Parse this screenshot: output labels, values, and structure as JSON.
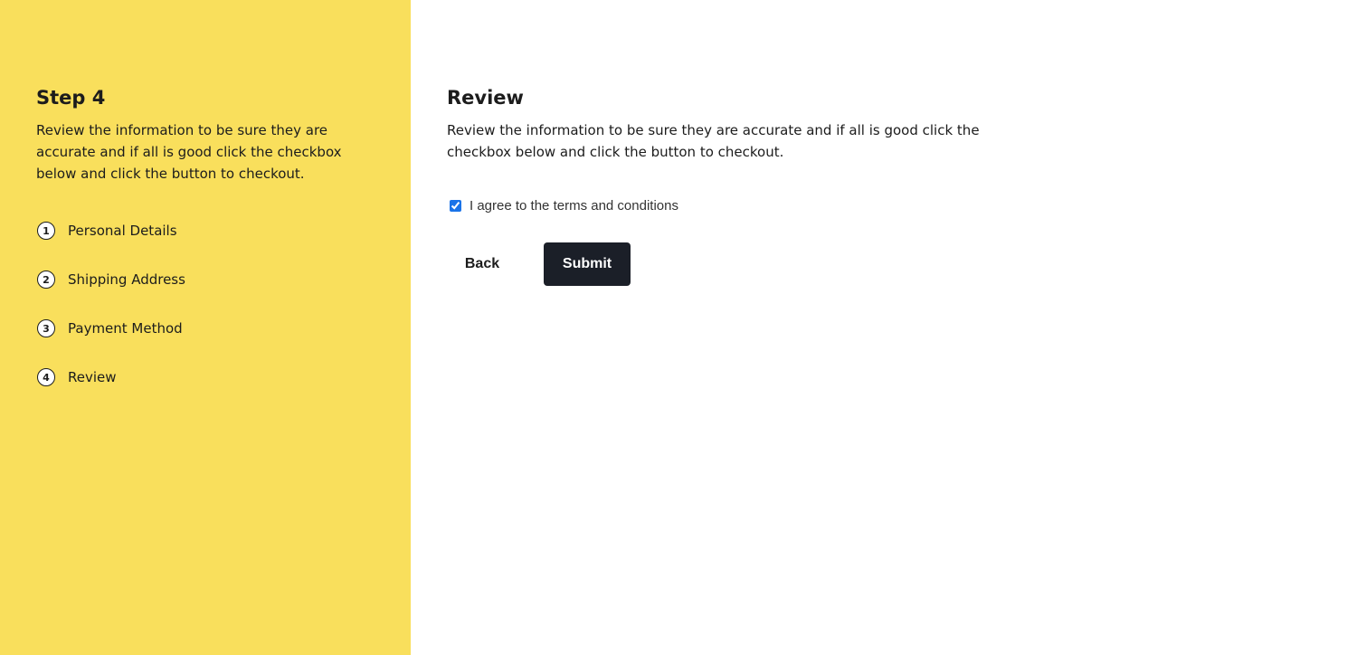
{
  "sidebar": {
    "title": "Step 4",
    "description": "Review the information to be sure they are accurate and if all is good click the checkbox below and click the button to checkout.",
    "steps": [
      {
        "number": "1",
        "label": "Personal Details"
      },
      {
        "number": "2",
        "label": "Shipping Address"
      },
      {
        "number": "3",
        "label": "Payment Method"
      },
      {
        "number": "4",
        "label": "Review"
      }
    ],
    "background_color": "#f9df5c"
  },
  "main": {
    "title": "Review",
    "description": "Review the information to be sure they are accurate and if all is good click the checkbox below and click the button to checkout.",
    "terms_label": "I agree to the terms and conditions",
    "terms_checked": true,
    "back_label": "Back",
    "submit_label": "Submit",
    "submit_color": "#1b1f28"
  }
}
